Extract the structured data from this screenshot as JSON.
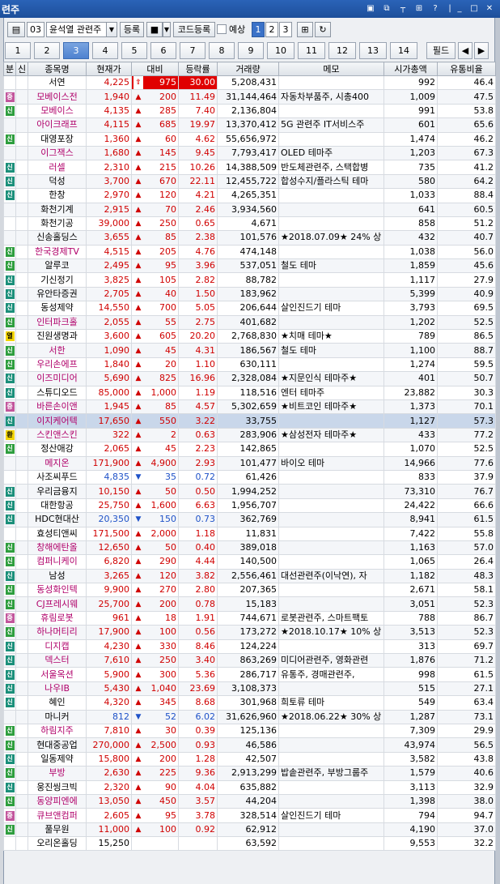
{
  "window": {
    "title": "련주"
  },
  "toolbar": {
    "num": "03",
    "group": "윤석열 관련주",
    "register": "등록",
    "code_register": "코드등록",
    "forecast": "예상",
    "pages": [
      "1",
      "2",
      "3"
    ],
    "field": "필드"
  },
  "tabs": [
    "1",
    "2",
    "3",
    "4",
    "5",
    "6",
    "7",
    "8",
    "9",
    "10",
    "11",
    "12",
    "13",
    "14"
  ],
  "active_tab": "3",
  "columns": [
    "분",
    "신",
    "종목명",
    "현재가",
    "대비",
    "등락률",
    "거래량",
    "메모",
    "시가총액",
    "유통비율"
  ],
  "colors": {
    "up": "#d00000",
    "down": "#1f52c8",
    "badge_green": "#2e9e3e",
    "badge_pink": "#c2559c",
    "badge_yellow": "#f2d400",
    "badge_cyan": "#1b8f7a"
  },
  "rows": [
    {
      "b": "",
      "bc": "",
      "name": "서연",
      "nc": "black",
      "price": "4,225",
      "pc": "red",
      "ar": "⇧",
      "chg": "975",
      "rate": "30.00",
      "vol": "5,208,431",
      "memo": "",
      "cap": "992",
      "ratio": "46.4",
      "hl": true
    },
    {
      "b": "증",
      "bc": "pink",
      "name": "모베이스전",
      "nc": "purple",
      "price": "1,940",
      "pc": "red",
      "ar": "▲",
      "chg": "200",
      "rate": "11.49",
      "vol": "31,144,464",
      "memo": "자동차부품주, 시총400",
      "cap": "1,009",
      "ratio": "47.5"
    },
    {
      "b": "신",
      "bc": "green",
      "name": "모베이스",
      "nc": "purple",
      "price": "4,135",
      "pc": "red",
      "ar": "▲",
      "chg": "285",
      "rate": "7.40",
      "vol": "2,136,804",
      "memo": "",
      "cap": "991",
      "ratio": "53.8"
    },
    {
      "b": "",
      "bc": "",
      "name": "아이크래프",
      "nc": "purple",
      "price": "4,115",
      "pc": "red",
      "ar": "▲",
      "chg": "685",
      "rate": "19.97",
      "vol": "13,370,412",
      "memo": "5G 관련주 IT서비스주",
      "cap": "601",
      "ratio": "65.6"
    },
    {
      "b": "신",
      "bc": "green",
      "name": "대영포장",
      "nc": "black",
      "price": "1,360",
      "pc": "red",
      "ar": "▲",
      "chg": "60",
      "rate": "4.62",
      "vol": "55,656,972",
      "memo": "",
      "cap": "1,474",
      "ratio": "46.2"
    },
    {
      "b": "",
      "bc": "",
      "name": "이그잭스",
      "nc": "purple",
      "price": "1,680",
      "pc": "red",
      "ar": "▲",
      "chg": "145",
      "rate": "9.45",
      "vol": "7,793,417",
      "memo": "OLED 테마주",
      "cap": "1,203",
      "ratio": "67.3"
    },
    {
      "b": "신",
      "bc": "cyan",
      "name": "러셀",
      "nc": "purple",
      "price": "2,310",
      "pc": "red",
      "ar": "▲",
      "chg": "215",
      "rate": "10.26",
      "vol": "14,388,509",
      "memo": "반도체관련주, 스택합병",
      "cap": "735",
      "ratio": "41.2"
    },
    {
      "b": "신",
      "bc": "cyan",
      "name": "덕성",
      "nc": "black",
      "price": "3,700",
      "pc": "red",
      "ar": "▲",
      "chg": "670",
      "rate": "22.11",
      "vol": "12,455,722",
      "memo": "합성수지/플라스틱 테마",
      "cap": "580",
      "ratio": "64.2"
    },
    {
      "b": "신",
      "bc": "cyan",
      "name": "한창",
      "nc": "black",
      "price": "2,970",
      "pc": "red",
      "ar": "▲",
      "chg": "120",
      "rate": "4.21",
      "vol": "4,265,351",
      "memo": "",
      "cap": "1,033",
      "ratio": "88.4"
    },
    {
      "b": "",
      "bc": "",
      "name": "화천기계",
      "nc": "black",
      "price": "2,915",
      "pc": "red",
      "ar": "▲",
      "chg": "70",
      "rate": "2.46",
      "vol": "3,934,560",
      "memo": "",
      "cap": "641",
      "ratio": "60.5"
    },
    {
      "b": "",
      "bc": "",
      "name": "화천기공",
      "nc": "black",
      "price": "39,000",
      "pc": "red",
      "ar": "▲",
      "chg": "250",
      "rate": "0.65",
      "vol": "4,671",
      "memo": "",
      "cap": "858",
      "ratio": "51.2"
    },
    {
      "b": "",
      "bc": "",
      "name": "신송홀딩스",
      "nc": "black",
      "price": "3,655",
      "pc": "red",
      "ar": "▲",
      "chg": "85",
      "rate": "2.38",
      "vol": "101,576",
      "memo": "★2018.07.09★ 24% 상",
      "cap": "432",
      "ratio": "40.7"
    },
    {
      "b": "신",
      "bc": "green",
      "name": "한국경제TV",
      "nc": "purple",
      "price": "4,515",
      "pc": "red",
      "ar": "▲",
      "chg": "205",
      "rate": "4.76",
      "vol": "474,148",
      "memo": "",
      "cap": "1,038",
      "ratio": "56.0"
    },
    {
      "b": "신",
      "bc": "green",
      "name": "알루코",
      "nc": "black",
      "price": "2,495",
      "pc": "red",
      "ar": "▲",
      "chg": "95",
      "rate": "3.96",
      "vol": "537,051",
      "memo": "철도 테마",
      "cap": "1,859",
      "ratio": "45.6"
    },
    {
      "b": "신",
      "bc": "cyan",
      "name": "기신정기",
      "nc": "black",
      "price": "3,825",
      "pc": "red",
      "ar": "▲",
      "chg": "105",
      "rate": "2.82",
      "vol": "88,782",
      "memo": "",
      "cap": "1,117",
      "ratio": "27.9"
    },
    {
      "b": "신",
      "bc": "cyan",
      "name": "유안타증권",
      "nc": "black",
      "price": "2,705",
      "pc": "red",
      "ar": "▲",
      "chg": "40",
      "rate": "1.50",
      "vol": "183,962",
      "memo": "",
      "cap": "5,399",
      "ratio": "40.9"
    },
    {
      "b": "신",
      "bc": "cyan",
      "name": "동성제약",
      "nc": "black",
      "price": "14,550",
      "pc": "red",
      "ar": "▲",
      "chg": "700",
      "rate": "5.05",
      "vol": "206,644",
      "memo": "살인진드기 테마",
      "cap": "3,793",
      "ratio": "69.5"
    },
    {
      "b": "신",
      "bc": "green",
      "name": "인터파크홀",
      "nc": "purple",
      "price": "2,055",
      "pc": "red",
      "ar": "▲",
      "chg": "55",
      "rate": "2.75",
      "vol": "401,682",
      "memo": "",
      "cap": "1,202",
      "ratio": "52.5"
    },
    {
      "b": "열",
      "bc": "yellow",
      "name": "진원생명과",
      "nc": "black",
      "price": "3,600",
      "pc": "red",
      "ar": "▲",
      "chg": "605",
      "rate": "20.20",
      "vol": "2,768,830",
      "memo": "★치매 테마★",
      "cap": "789",
      "ratio": "86.5"
    },
    {
      "b": "신",
      "bc": "green",
      "name": "서한",
      "nc": "purple",
      "price": "1,090",
      "pc": "red",
      "ar": "▲",
      "chg": "45",
      "rate": "4.31",
      "vol": "186,567",
      "memo": "철도 테마",
      "cap": "1,100",
      "ratio": "88.7"
    },
    {
      "b": "신",
      "bc": "green",
      "name": "우리손에프",
      "nc": "purple",
      "price": "1,840",
      "pc": "red",
      "ar": "▲",
      "chg": "20",
      "rate": "1.10",
      "vol": "630,111",
      "memo": "",
      "cap": "1,274",
      "ratio": "59.5"
    },
    {
      "b": "신",
      "bc": "cyan",
      "name": "이즈미디어",
      "nc": "purple",
      "price": "5,690",
      "pc": "red",
      "ar": "▲",
      "chg": "825",
      "rate": "16.96",
      "vol": "2,328,084",
      "memo": "★지문인식 테마주★",
      "cap": "401",
      "ratio": "50.7"
    },
    {
      "b": "신",
      "bc": "cyan",
      "name": "스튜디오드",
      "nc": "black",
      "price": "85,000",
      "pc": "red",
      "ar": "▲",
      "chg": "1,000",
      "rate": "1.19",
      "vol": "118,516",
      "memo": "엔터 테마주",
      "cap": "23,882",
      "ratio": "30.3"
    },
    {
      "b": "증",
      "bc": "pink",
      "name": "바른손이앤",
      "nc": "purple",
      "price": "1,945",
      "pc": "red",
      "ar": "▲",
      "chg": "85",
      "rate": "4.57",
      "vol": "5,302,659",
      "memo": "★비트코인 테마주★",
      "cap": "1,373",
      "ratio": "70.1"
    },
    {
      "b": "신",
      "bc": "cyan",
      "name": "이지케어텍",
      "nc": "purple",
      "price": "17,650",
      "pc": "red",
      "ar": "▲",
      "chg": "550",
      "rate": "3.22",
      "vol": "33,755",
      "memo": "",
      "cap": "1,127",
      "ratio": "57.3",
      "sel": true
    },
    {
      "b": "환",
      "bc": "yellow",
      "name": "스킨앤스킨",
      "nc": "purple",
      "price": "322",
      "pc": "red",
      "ar": "▲",
      "chg": "2",
      "rate": "0.63",
      "vol": "283,906",
      "memo": "★삼성전자 테마주★",
      "cap": "433",
      "ratio": "77.2"
    },
    {
      "b": "신",
      "bc": "green",
      "name": "정산애강",
      "nc": "black",
      "price": "2,065",
      "pc": "red",
      "ar": "▲",
      "chg": "45",
      "rate": "2.23",
      "vol": "142,865",
      "memo": "",
      "cap": "1,070",
      "ratio": "52.5"
    },
    {
      "b": "",
      "bc": "",
      "name": "메지온",
      "nc": "purple",
      "price": "171,900",
      "pc": "red",
      "ar": "▲",
      "chg": "4,900",
      "rate": "2.93",
      "vol": "101,477",
      "memo": "바이오 테마",
      "cap": "14,966",
      "ratio": "77.6"
    },
    {
      "b": "",
      "bc": "",
      "name": "사조씨푸드",
      "nc": "black",
      "price": "4,835",
      "pc": "blue",
      "ar": "▼",
      "chg": "35",
      "rate": "0.72",
      "vol": "61,426",
      "memo": "",
      "cap": "833",
      "ratio": "37.9"
    },
    {
      "b": "신",
      "bc": "cyan",
      "name": "우리금융지",
      "nc": "black",
      "price": "10,150",
      "pc": "red",
      "ar": "▲",
      "chg": "50",
      "rate": "0.50",
      "vol": "1,994,252",
      "memo": "",
      "cap": "73,310",
      "ratio": "76.7"
    },
    {
      "b": "신",
      "bc": "cyan",
      "name": "대한항공",
      "nc": "black",
      "price": "25,750",
      "pc": "red",
      "ar": "▲",
      "chg": "1,600",
      "rate": "6.63",
      "vol": "1,956,707",
      "memo": "",
      "cap": "24,422",
      "ratio": "66.6"
    },
    {
      "b": "신",
      "bc": "cyan",
      "name": "HDC현대산",
      "nc": "black",
      "price": "20,350",
      "pc": "blue",
      "ar": "▼",
      "chg": "150",
      "rate": "0.73",
      "vol": "362,769",
      "memo": "",
      "cap": "8,941",
      "ratio": "61.5"
    },
    {
      "b": "",
      "bc": "",
      "name": "효성티앤씨",
      "nc": "black",
      "price": "171,500",
      "pc": "red",
      "ar": "▲",
      "chg": "2,000",
      "rate": "1.18",
      "vol": "11,831",
      "memo": "",
      "cap": "7,422",
      "ratio": "55.8"
    },
    {
      "b": "신",
      "bc": "green",
      "name": "창해에탄올",
      "nc": "purple",
      "price": "12,650",
      "pc": "red",
      "ar": "▲",
      "chg": "50",
      "rate": "0.40",
      "vol": "389,018",
      "memo": "",
      "cap": "1,163",
      "ratio": "57.0"
    },
    {
      "b": "신",
      "bc": "green",
      "name": "컴퍼니케이",
      "nc": "purple",
      "price": "6,820",
      "pc": "red",
      "ar": "▲",
      "chg": "290",
      "rate": "4.44",
      "vol": "140,500",
      "memo": "",
      "cap": "1,065",
      "ratio": "26.4"
    },
    {
      "b": "신",
      "bc": "cyan",
      "name": "남성",
      "nc": "black",
      "price": "3,265",
      "pc": "red",
      "ar": "▲",
      "chg": "120",
      "rate": "3.82",
      "vol": "2,556,461",
      "memo": "대선관련주(이낙연), 자",
      "cap": "1,182",
      "ratio": "48.3"
    },
    {
      "b": "신",
      "bc": "green",
      "name": "동성화인텍",
      "nc": "purple",
      "price": "9,900",
      "pc": "red",
      "ar": "▲",
      "chg": "270",
      "rate": "2.80",
      "vol": "207,365",
      "memo": "",
      "cap": "2,671",
      "ratio": "58.1"
    },
    {
      "b": "신",
      "bc": "green",
      "name": "CJ프레시웨",
      "nc": "purple",
      "price": "25,700",
      "pc": "red",
      "ar": "▲",
      "chg": "200",
      "rate": "0.78",
      "vol": "15,183",
      "memo": "",
      "cap": "3,051",
      "ratio": "52.3"
    },
    {
      "b": "증",
      "bc": "pink",
      "name": "휴림로봇",
      "nc": "purple",
      "price": "961",
      "pc": "red",
      "ar": "▲",
      "chg": "18",
      "rate": "1.91",
      "vol": "744,671",
      "memo": "로봇관련주, 스마트팩토",
      "cap": "788",
      "ratio": "86.7"
    },
    {
      "b": "신",
      "bc": "green",
      "name": "하나머티리",
      "nc": "purple",
      "price": "17,900",
      "pc": "red",
      "ar": "▲",
      "chg": "100",
      "rate": "0.56",
      "vol": "173,272",
      "memo": "★2018.10.17★ 10% 상",
      "cap": "3,513",
      "ratio": "52.3"
    },
    {
      "b": "신",
      "bc": "cyan",
      "name": "디지캡",
      "nc": "purple",
      "price": "4,230",
      "pc": "red",
      "ar": "▲",
      "chg": "330",
      "rate": "8.46",
      "vol": "124,224",
      "memo": "",
      "cap": "313",
      "ratio": "69.7"
    },
    {
      "b": "신",
      "bc": "cyan",
      "name": "덱스터",
      "nc": "purple",
      "price": "7,610",
      "pc": "red",
      "ar": "▲",
      "chg": "250",
      "rate": "3.40",
      "vol": "863,269",
      "memo": "미디어관련주, 영화관련",
      "cap": "1,876",
      "ratio": "71.2"
    },
    {
      "b": "신",
      "bc": "cyan",
      "name": "서울옥션",
      "nc": "purple",
      "price": "5,900",
      "pc": "red",
      "ar": "▲",
      "chg": "300",
      "rate": "5.36",
      "vol": "286,717",
      "memo": " 유통주, 경매관련주,",
      "cap": "998",
      "ratio": "61.5"
    },
    {
      "b": "신",
      "bc": "cyan",
      "name": "나우IB",
      "nc": "purple",
      "price": "5,430",
      "pc": "red",
      "ar": "▲",
      "chg": "1,040",
      "rate": "23.69",
      "vol": "3,108,373",
      "memo": "",
      "cap": "515",
      "ratio": "27.1"
    },
    {
      "b": "신",
      "bc": "cyan",
      "name": "혜인",
      "nc": "black",
      "price": "4,320",
      "pc": "red",
      "ar": "▲",
      "chg": "345",
      "rate": "8.68",
      "vol": "301,968",
      "memo": "희토류 테마",
      "cap": "549",
      "ratio": "63.4"
    },
    {
      "b": "",
      "bc": "",
      "name": "마니커",
      "nc": "black",
      "price": "812",
      "pc": "blue",
      "ar": "▼",
      "chg": "52",
      "rate": "6.02",
      "vol": "31,626,960",
      "memo": "★2018.06.22★ 30% 상",
      "cap": "1,287",
      "ratio": "73.1"
    },
    {
      "b": "신",
      "bc": "green",
      "name": "하림지주",
      "nc": "purple",
      "price": "7,810",
      "pc": "red",
      "ar": "▲",
      "chg": "30",
      "rate": "0.39",
      "vol": "125,136",
      "memo": "",
      "cap": "7,309",
      "ratio": "29.9"
    },
    {
      "b": "신",
      "bc": "green",
      "name": "현대중공업",
      "nc": "black",
      "price": "270,000",
      "pc": "red",
      "ar": "▲",
      "chg": "2,500",
      "rate": "0.93",
      "vol": "46,586",
      "memo": "",
      "cap": "43,974",
      "ratio": "56.5"
    },
    {
      "b": "신",
      "bc": "cyan",
      "name": "일동제약",
      "nc": "black",
      "price": "15,800",
      "pc": "red",
      "ar": "▲",
      "chg": "200",
      "rate": "1.28",
      "vol": "42,507",
      "memo": "",
      "cap": "3,582",
      "ratio": "43.8"
    },
    {
      "b": "신",
      "bc": "green",
      "name": "부방",
      "nc": "purple",
      "price": "2,630",
      "pc": "red",
      "ar": "▲",
      "chg": "225",
      "rate": "9.36",
      "vol": "2,913,299",
      "memo": "밥솥관련주, 부방그룹주",
      "cap": "1,579",
      "ratio": "40.6"
    },
    {
      "b": "신",
      "bc": "cyan",
      "name": "웅진씽크빅",
      "nc": "black",
      "price": "2,320",
      "pc": "red",
      "ar": "▲",
      "chg": "90",
      "rate": "4.04",
      "vol": "635,882",
      "memo": "",
      "cap": "3,113",
      "ratio": "32.9"
    },
    {
      "b": "신",
      "bc": "green",
      "name": "동양피엔에",
      "nc": "purple",
      "price": "13,050",
      "pc": "red",
      "ar": "▲",
      "chg": "450",
      "rate": "3.57",
      "vol": "44,204",
      "memo": "",
      "cap": "1,398",
      "ratio": "38.0"
    },
    {
      "b": "증",
      "bc": "pink",
      "name": "큐브앤컴퍼",
      "nc": "purple",
      "price": "2,605",
      "pc": "red",
      "ar": "▲",
      "chg": "95",
      "rate": "3.78",
      "vol": "328,514",
      "memo": "살인진드기 테마",
      "cap": "794",
      "ratio": "94.7"
    },
    {
      "b": "신",
      "bc": "green",
      "name": "풀무원",
      "nc": "black",
      "price": "11,000",
      "pc": "red",
      "ar": "▲",
      "chg": "100",
      "rate": "0.92",
      "vol": "62,912",
      "memo": "",
      "cap": "4,190",
      "ratio": "37.0"
    },
    {
      "b": "",
      "bc": "",
      "name": "오리온홀딩",
      "nc": "black",
      "price": "15,250",
      "pc": "black",
      "ar": "",
      "chg": "",
      "rate": "",
      "vol": "63,592",
      "memo": "",
      "cap": "9,553",
      "ratio": "32.2"
    }
  ]
}
